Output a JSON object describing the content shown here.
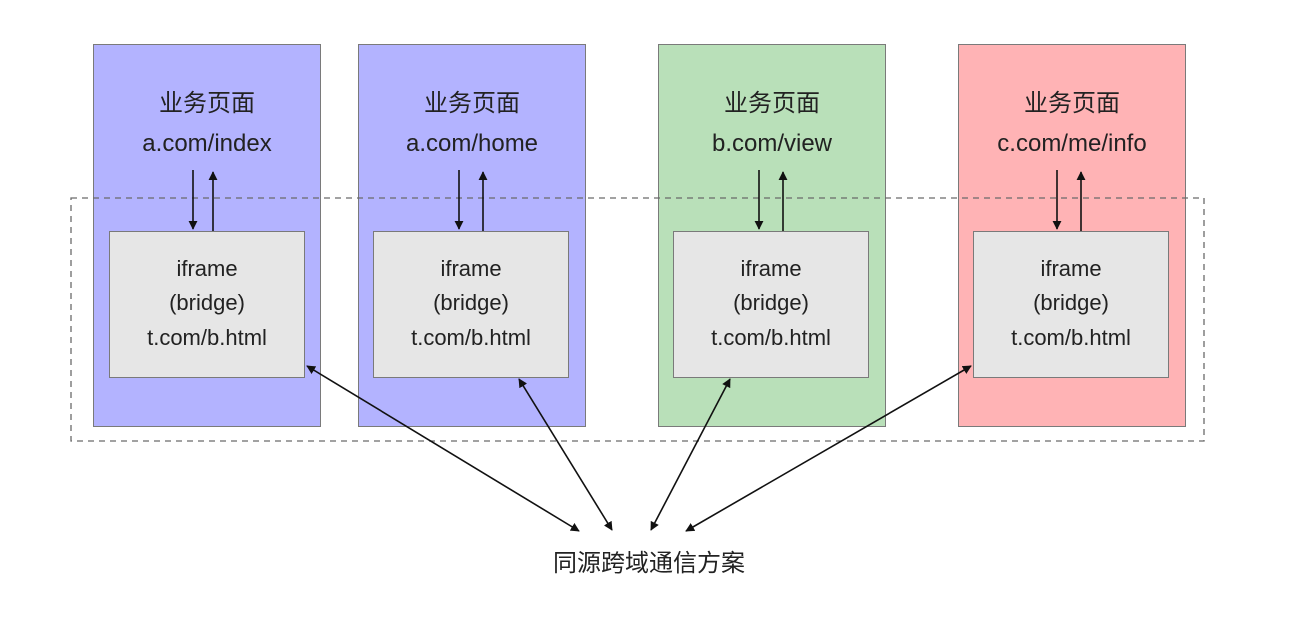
{
  "pages": [
    {
      "title": "业务页面",
      "url": "a.com/index",
      "color": "#b3b3ff"
    },
    {
      "title": "业务页面",
      "url": "a.com/home",
      "color": "#b3b3ff"
    },
    {
      "title": "业务页面",
      "url": "b.com/view",
      "color": "#b9e0b9"
    },
    {
      "title": "业务页面",
      "url": "c.com/me/info",
      "color": "#ffb3b5"
    }
  ],
  "bridge": {
    "line1": "iframe",
    "line2": "(bridge)",
    "line3": "t.com/b.html",
    "color": "#e6e6e6"
  },
  "caption": "同源跨域通信方案"
}
